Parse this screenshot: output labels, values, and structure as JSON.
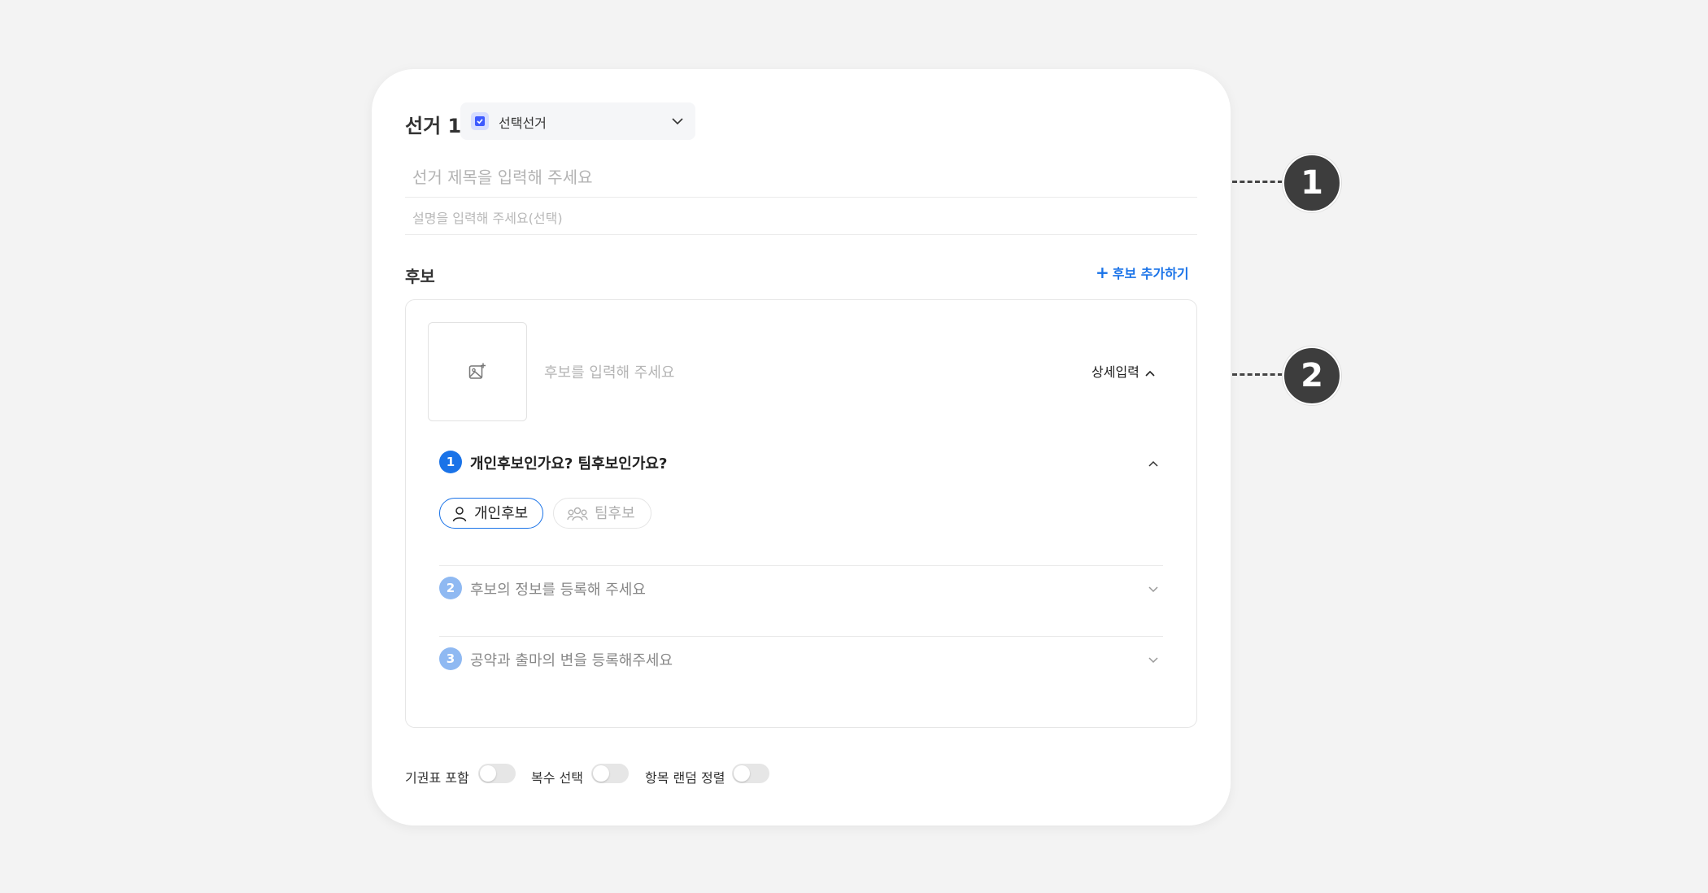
{
  "election": {
    "label": "선거 1",
    "type_select": {
      "value": "선택선거",
      "checked": true
    },
    "title_placeholder": "선거 제목을 입력해 주세요",
    "description_placeholder": "설명을 입력해 주세요(선택)"
  },
  "candidates": {
    "label": "후보",
    "add_button": {
      "icon": "+",
      "label": "후보 추가하기"
    },
    "item": {
      "name_placeholder": "후보를 입력해 주세요",
      "detail_toggle": "상세입력",
      "steps": [
        {
          "number": "1",
          "question": "개인후보인가요? 팀후보인가요?",
          "expanded": true
        },
        {
          "number": "2",
          "question": "후보의 정보를 등록해 주세요",
          "expanded": false
        },
        {
          "number": "3",
          "question": "공약과 출마의 변을 등록해주세요",
          "expanded": false
        }
      ],
      "type_options": [
        {
          "label": "개인후보",
          "selected": true,
          "icon": "person-icon"
        },
        {
          "label": "팀후보",
          "selected": false,
          "icon": "team-icon"
        }
      ]
    }
  },
  "toggles": [
    {
      "label": "기권표 포함",
      "on": false
    },
    {
      "label": "복수 선택",
      "on": false
    },
    {
      "label": "항목 랜덤 정렬",
      "on": false
    }
  ],
  "callouts": [
    "1",
    "2"
  ],
  "colors": {
    "accent": "#1a73e8",
    "accent_light": "#8fb9f2",
    "checkbox": "#3d5afe",
    "callout": "#3d3d3d"
  }
}
